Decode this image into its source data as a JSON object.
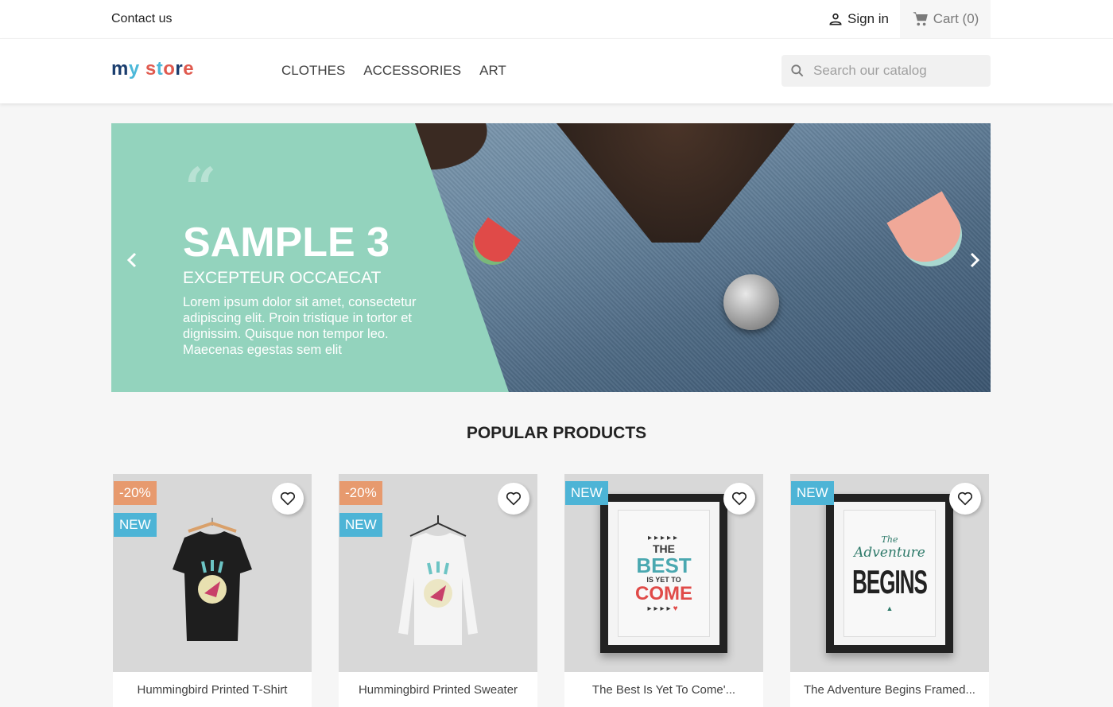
{
  "topbar": {
    "contact_label": "Contact us",
    "signin_label": "Sign in",
    "cart_label": "Cart (0)"
  },
  "header": {
    "logo_text": "my store",
    "nav": [
      {
        "label": "CLOTHES"
      },
      {
        "label": "ACCESSORIES"
      },
      {
        "label": "ART"
      }
    ],
    "search": {
      "placeholder": "Search our catalog",
      "value": ""
    }
  },
  "slider": {
    "quote_mark": "“",
    "title": "SAMPLE 3",
    "subtitle": "EXCEPTEUR OCCAECAT",
    "text": "Lorem ipsum dolor sit amet, consectetur adipiscing elit. Proin tristique in tortor et dignissim. Quisque non tempor leo. Maecenas egestas sem elit",
    "prev_icon": "‹",
    "next_icon": "›"
  },
  "popular": {
    "title": "POPULAR PRODUCTS",
    "products": [
      {
        "name": "Hummingbird Printed T-Shirt",
        "discount": "-20%",
        "flag": "NEW"
      },
      {
        "name": "Hummingbird Printed Sweater",
        "discount": "-20%",
        "flag": "NEW"
      },
      {
        "name": "The Best Is Yet To Come'...",
        "flag": "NEW",
        "art_lines": [
          "THE",
          "BEST",
          "IS YET TO",
          "COME"
        ]
      },
      {
        "name": "The Adventure Begins Framed...",
        "flag": "NEW",
        "art_lines": [
          "The",
          "Adventure",
          "BEGINS"
        ]
      }
    ]
  },
  "colors": {
    "slide_panel": "#93d3bd",
    "discount_flag": "#e79a6e",
    "new_flag": "#4db4d6"
  }
}
